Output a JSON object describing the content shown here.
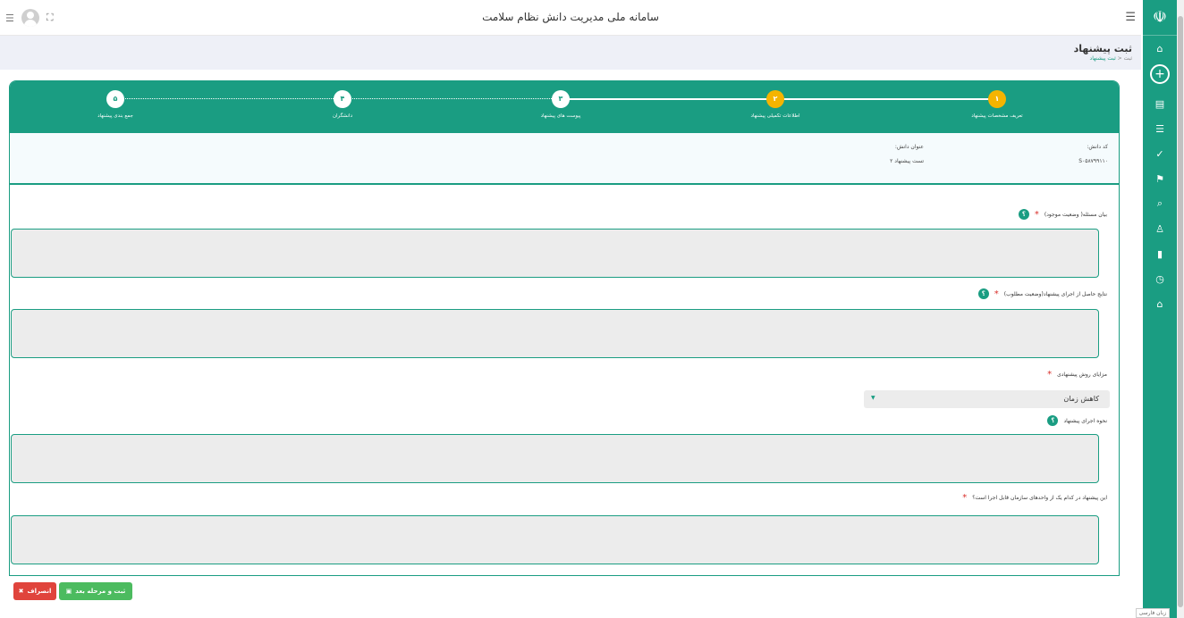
{
  "app": {
    "title": "سامانه ملی مدیریت دانش نظام سلامت"
  },
  "page": {
    "title": "ثبت پیشنهاد",
    "breadcrumb_root": "ثبت",
    "breadcrumb_sep": "<",
    "breadcrumb_current": "ثبت پیشنهاد"
  },
  "steps": [
    {
      "num": "۱",
      "label": "تعریف مشخصات پیشنهاد",
      "state": "active"
    },
    {
      "num": "۲",
      "label": "اطلاعات تکمیلی پیشنهاد",
      "state": "active"
    },
    {
      "num": "۳",
      "label": "پیوست های پیشنهاد",
      "state": "pending"
    },
    {
      "num": "۴",
      "label": "دانشگران",
      "state": "pending"
    },
    {
      "num": "۵",
      "label": "جمع بندی پیشنهاد",
      "state": "pending"
    }
  ],
  "info": {
    "code_label": "کد دانش:",
    "code_value": "S۰۵۸۷۹۹۱۱۰",
    "title_label": "عنوان دانش:",
    "title_value": "تست پیشنهاد ۲"
  },
  "fields": {
    "problem_label": "بیان مسئله( وضعیت موجود)",
    "results_label": "نتایج حاصل از اجرای پیشنهاد(وضعیت مطلوب)",
    "advantages_label": "مزایای روش پیشنهادی",
    "advantages_value": "کاهش زمان",
    "method_label": "نحوه اجرای پیشنهاد",
    "units_label": "این پیشنهاد در کدام یک از واحدهای سازمان قابل اجرا است؟",
    "required_mark": "*",
    "help_mark": "؟"
  },
  "buttons": {
    "save_next": "ثبت و مرحله بعد",
    "cancel": "انصراف"
  },
  "corner_text": "زبان فارسی",
  "icons": {
    "sidebar": [
      "home-icon",
      "plus-circle-icon",
      "calendar-icon",
      "list-icon",
      "check-icon",
      "graduation-icon",
      "search-icon",
      "user-icon",
      "document-icon",
      "clock-icon",
      "shop-icon"
    ]
  },
  "colors": {
    "primary": "#1a9d82",
    "active_step": "#f5b400",
    "save": "#4cbb5f",
    "cancel": "#e0443c"
  }
}
